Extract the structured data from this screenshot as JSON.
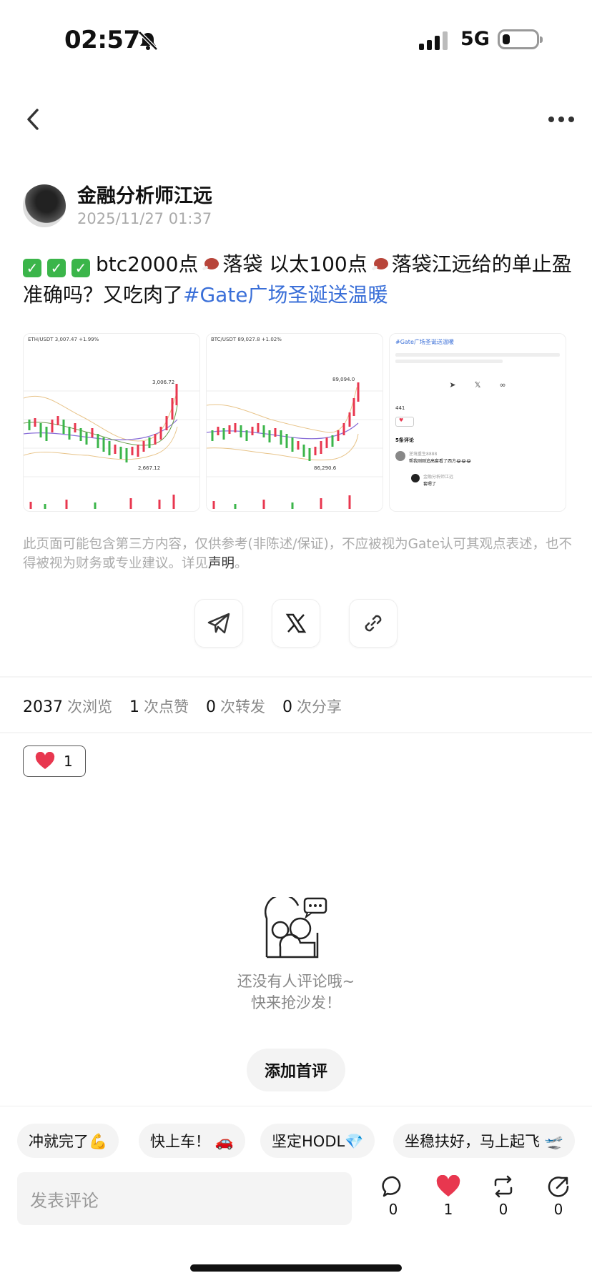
{
  "status_bar": {
    "time": "02:57",
    "network": "5G"
  },
  "author": {
    "name": "金融分析师江远",
    "date": "2025/11/27 01:37"
  },
  "post": {
    "part1": "btc2000点",
    "part2": "落袋 以太100点",
    "part3": "落袋江远给的单止盈准确吗？又吃肉了",
    "hashtag": "#Gate广场圣诞送温暖"
  },
  "images": [
    {
      "header": "ETH/USDT 3,007.47 +1.99%",
      "label": "3,006.72",
      "low": "2,667.12"
    },
    {
      "header": "BTC/USDT 89,027.8 +1.02%",
      "label": "89,094.0",
      "low": "86,290.6"
    },
    {
      "header": "#Gate广场圣诞送温暖",
      "stats": "441",
      "comments_title": "5条评论",
      "comment1_user": "逆境重生8888",
      "comment1": "帮我刚刚追高套看了西方😂😂😂",
      "comment2_user": "金融分析师江远",
      "comment2": "套嗯了"
    }
  ],
  "disclaimer": {
    "text": "此页面可能包含第三方内容，仅供参考(非陈述/保证)，不应被视为Gate认可其观点表述，也不得被视为财务或专业建议。详见",
    "link": "声明",
    "end": "。"
  },
  "stats": {
    "views": "2037",
    "views_label": "次浏览",
    "likes": "1",
    "likes_label": "次点赞",
    "reposts": "0",
    "reposts_label": "次转发",
    "shares": "0",
    "shares_label": "次分享"
  },
  "like_chip": {
    "count": "1"
  },
  "empty_state": {
    "line1": "还没有人评论哦~",
    "line2": "快来抢沙发！",
    "button": "添加首评"
  },
  "quick_replies": [
    "冲就完了💪",
    "快上车！ 🚗",
    "坚定HODL💎",
    "坐稳扶好，马上起飞 🛫"
  ],
  "comment_bar": {
    "placeholder": "发表评论",
    "comments": "0",
    "likes": "1",
    "reposts": "0",
    "shares": "0"
  },
  "colors": {
    "accent": "#3a6fd8",
    "like": "#e8374f",
    "check": "#3bb54a"
  }
}
